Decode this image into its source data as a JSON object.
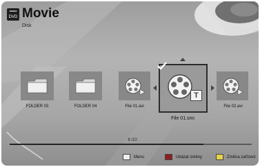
{
  "header": {
    "icon_text": "DVD",
    "title": "Movie",
    "subtitle": "Disk"
  },
  "items": [
    {
      "type": "folder",
      "label": "FOLDER 03"
    },
    {
      "type": "folder",
      "label": "FOLDER 04"
    },
    {
      "type": "video",
      "label": "File 01.avi"
    },
    {
      "type": "video-subtitle",
      "label": "File 01.smi",
      "selected": true,
      "checked": true
    },
    {
      "type": "video",
      "label": "File 02.avi"
    }
  ],
  "progress": {
    "text": "8 /10",
    "fraction": 0.8
  },
  "footer": {
    "menu_label": "Menu",
    "show_changes_label": "Ukázat změny",
    "change_device_label": "Změna zařízení"
  },
  "colors": {
    "hint_red": "#8b2020",
    "hint_yellow": "#e6d44a",
    "hint_blue": "#3d63b8"
  }
}
